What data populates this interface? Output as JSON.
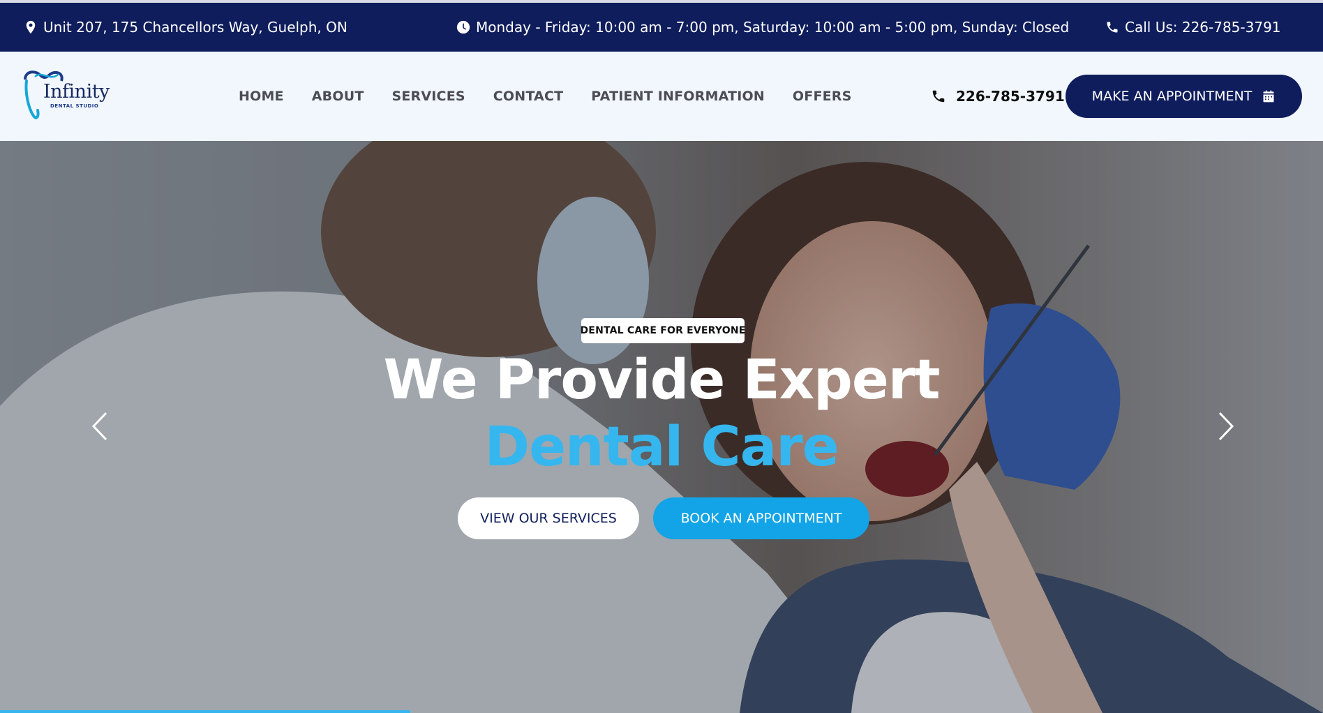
{
  "topbar": {
    "address": "Unit 207, 175 Chancellors Way, Guelph, ON",
    "hours": "Monday - Friday: 10:00 am - 7:00 pm, Saturday: 10:00 am - 5:00 pm, Sunday: Closed",
    "call": "Call Us: 226-785-3791",
    "icons": [
      "map-pin-icon",
      "clock-icon",
      "phone-icon"
    ]
  },
  "logo": {
    "name": "Infinity",
    "subtitle": "DENTAL STUDIO"
  },
  "nav": {
    "items": [
      "HOME",
      "ABOUT",
      "SERVICES",
      "CONTACT",
      "PATIENT INFORMATION",
      "OFFERS"
    ]
  },
  "header": {
    "phone": "226-785-3791",
    "appointment_button": "MAKE AN APPOINTMENT"
  },
  "hero": {
    "badge": "DENTAL CARE FOR EVERYONE",
    "title_line1": "We Provide Expert",
    "title_line2": "Dental Care",
    "services_button": "VIEW OUR SERVICES",
    "book_button": "BOOK AN APPOINTMENT",
    "slider_progress": 0.31
  },
  "colors": {
    "navy": "#0f1d5c",
    "accent_blue": "#36b6ee",
    "button_blue": "#12a4e6",
    "header_bg": "#f1f7fd"
  }
}
